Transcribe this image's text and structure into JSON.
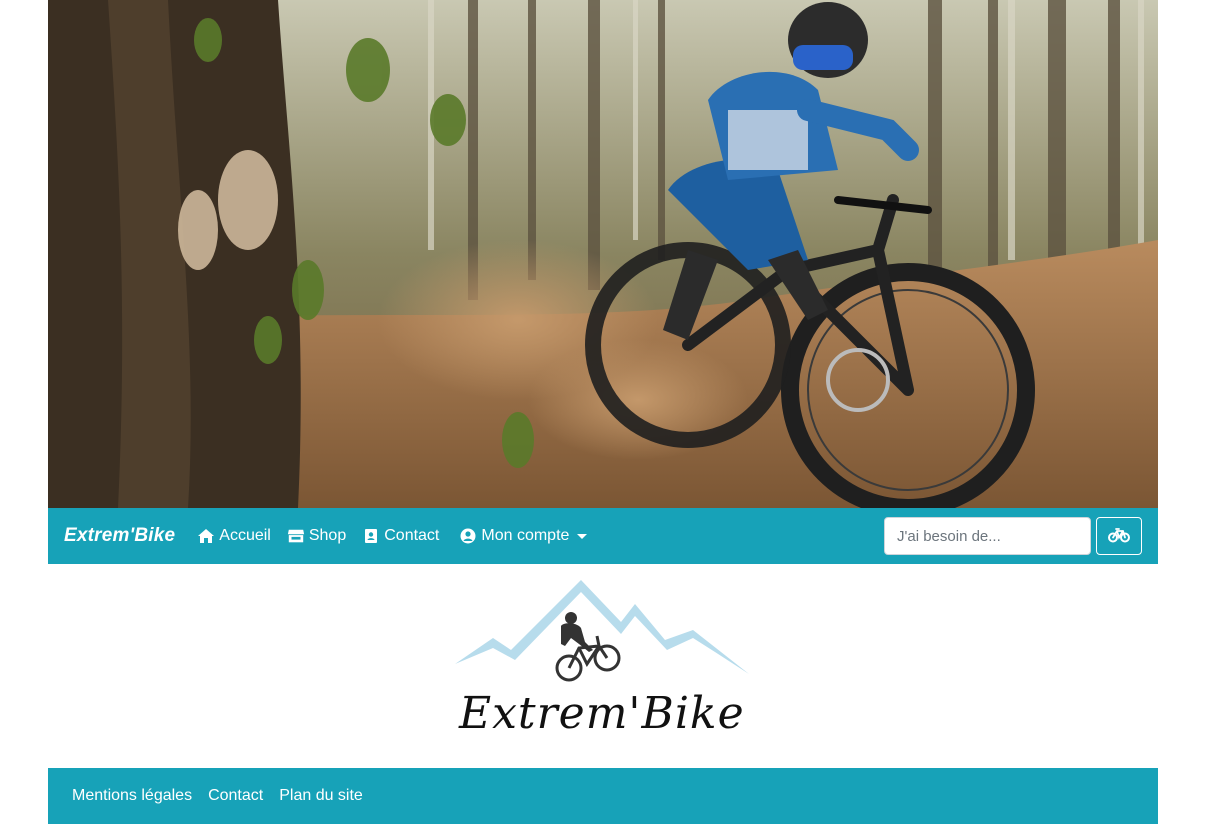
{
  "hero": {
    "image": "mountain-biker-in-forest-photo"
  },
  "navbar": {
    "brand": "Extrem'Bike",
    "items": [
      {
        "label": "Accueil",
        "icon": "home-icon"
      },
      {
        "label": "Shop",
        "icon": "store-icon"
      },
      {
        "label": "Contact",
        "icon": "contact-book-icon"
      },
      {
        "label": "Mon compte",
        "icon": "user-circle-icon"
      }
    ],
    "search": {
      "placeholder": "J'ai besoin de...",
      "button_icon": "bicycle-icon"
    },
    "color": "#17a2b8"
  },
  "logo": {
    "text": "Extrem'Bike"
  },
  "footer": {
    "links": [
      "Mentions légales",
      "Contact",
      "Plan du site"
    ]
  }
}
